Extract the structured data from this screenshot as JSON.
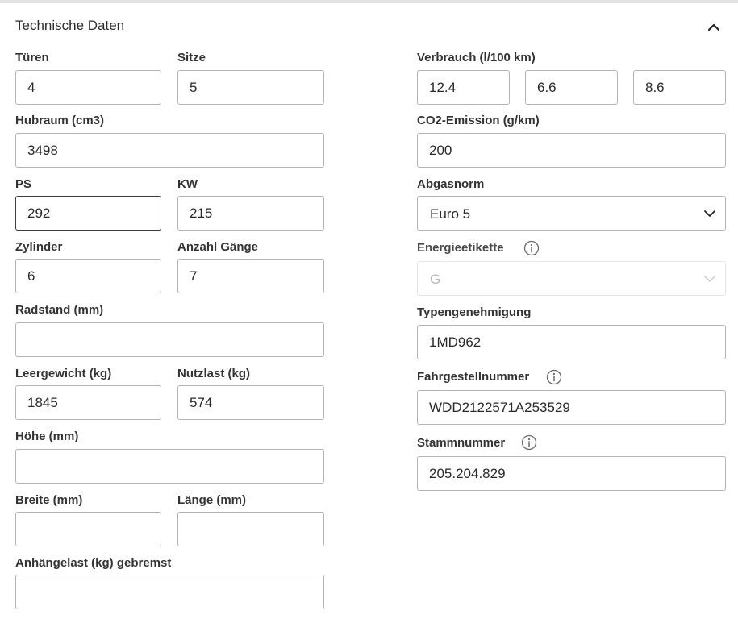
{
  "panel": {
    "title": "Technische Daten",
    "collapse_icon": "chevron-up-icon"
  },
  "left": {
    "doors": {
      "label": "Türen",
      "value": "4"
    },
    "seats": {
      "label": "Sitze",
      "value": "5"
    },
    "displacement": {
      "label": "Hubraum (cm3)",
      "value": "3498"
    },
    "ps": {
      "label": "PS",
      "value": "292"
    },
    "kw": {
      "label": "KW",
      "value": "215"
    },
    "cylinders": {
      "label": "Zylinder",
      "value": "6"
    },
    "gears": {
      "label": "Anzahl Gänge",
      "value": "7"
    },
    "wheelbase": {
      "label": "Radstand (mm)",
      "value": ""
    },
    "curb_weight": {
      "label": "Leergewicht (kg)",
      "value": "1845"
    },
    "payload": {
      "label": "Nutzlast (kg)",
      "value": "574"
    },
    "height": {
      "label": "Höhe (mm)",
      "value": ""
    },
    "width": {
      "label": "Breite (mm)",
      "value": ""
    },
    "length": {
      "label": "Länge (mm)",
      "value": ""
    },
    "trailer_load": {
      "label": "Anhängelast (kg) gebremst",
      "value": ""
    }
  },
  "right": {
    "consumption": {
      "label": "Verbrauch (l/100 km)",
      "values": [
        "12.4",
        "6.6",
        "8.6"
      ]
    },
    "co2": {
      "label": "CO2-Emission (g/km)",
      "value": "200"
    },
    "emission_norm": {
      "label": "Abgasnorm",
      "value": "Euro 5"
    },
    "energy_label": {
      "label": "Energieetikette",
      "value": "G"
    },
    "type_approval": {
      "label": "Typengenehmigung",
      "value": "1MD962"
    },
    "vin": {
      "label": "Fahrgestellnummer",
      "value": "WDD2122571A253529"
    },
    "master_number": {
      "label": "Stammnummer",
      "value": "205.204.829"
    }
  },
  "icons": {
    "info": "info-circle-icon",
    "dropdown": "chevron-down-icon"
  }
}
